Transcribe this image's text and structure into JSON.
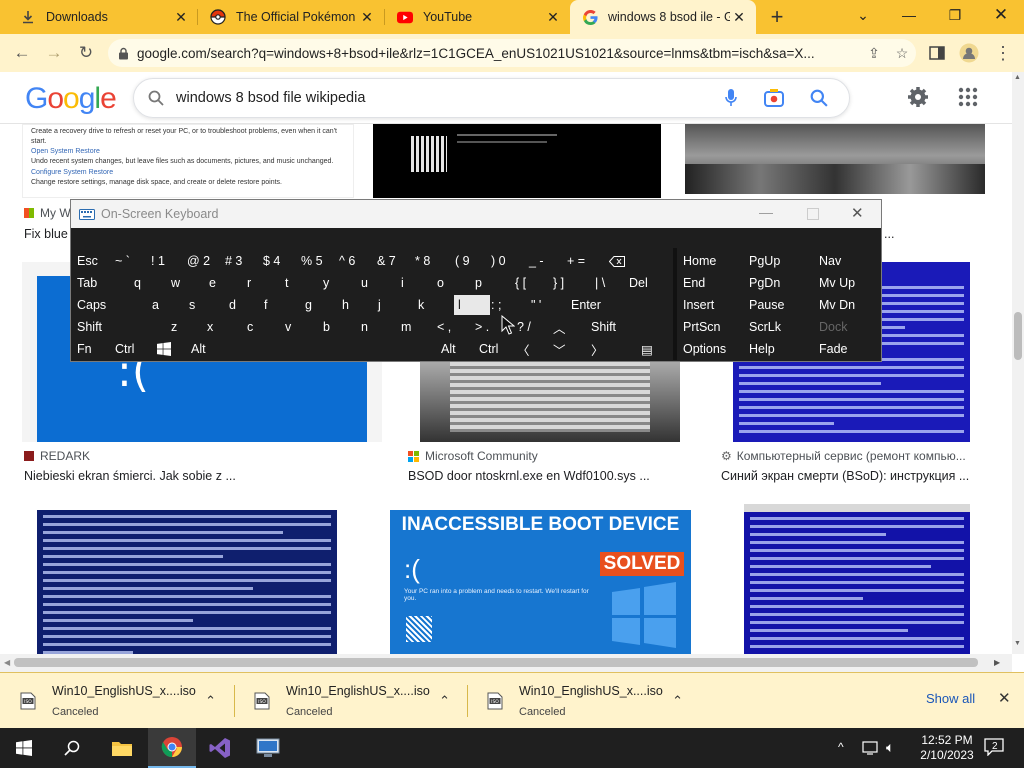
{
  "browser": {
    "tabs": [
      {
        "title": "Downloads",
        "icon": "download-icon"
      },
      {
        "title": "The Official Pokémon W",
        "icon": "pokeball-icon"
      },
      {
        "title": "YouTube",
        "icon": "youtube-icon"
      },
      {
        "title": "windows 8 bsod ile - G",
        "icon": "google-icon",
        "active": true
      }
    ],
    "new_tab": "+",
    "url": "google.com/search?q=windows+8+bsod+ile&rlz=1C1GCEA_enUS1021US1021&source=lnms&tbm=isch&sa=X...",
    "colors": {
      "tabstrip": "#f9c231",
      "toolbar": "#fff3cc"
    }
  },
  "google": {
    "logo": "Google",
    "query": "windows 8 bsod file wikipedia"
  },
  "results": {
    "row1": [
      {
        "source": "My W",
        "title": "Fix blue"
      },
      {
        "source": "",
        "title": ""
      },
      {
        "source": "",
        "title": "..."
      }
    ],
    "row2": [
      {
        "source": "REDARK",
        "title": "Niebieski ekran śmierci. Jak sobie z ..."
      },
      {
        "source": "Microsoft Community",
        "title": "BSOD door ntoskrnl.exe en Wdf0100.sys ..."
      },
      {
        "source": "Компьютерный сервис (ремонт компью...",
        "title": "Синий экран смерти (BSoD): инструкция ..."
      }
    ],
    "row1_left_text": [
      "Create a recovery drive to refresh or reset your PC, or to troubleshoot problems, even when it can't start.",
      "Open System Restore",
      "Undo recent system changes, but leave files such as documents, pictures, and music unchanged.",
      "Configure System Restore",
      "Change restore settings, manage disk space, and create or delete restore points."
    ],
    "inaccessible": {
      "headline": "INACCESSIBLE BOOT DEVICE",
      "badge": "SOLVED",
      "sad": ":(",
      "msg": "Your PC ran into a problem and needs to restart. We'll restart for you."
    }
  },
  "osk": {
    "title": "On-Screen Keyboard",
    "row1": [
      "Esc",
      "~ `",
      "! 1",
      "@ 2",
      "# 3",
      "$ 4",
      "% 5",
      "^ 6",
      "& 7",
      "* 8",
      "( 9",
      ") 0",
      "_ -",
      "+ ="
    ],
    "row2": [
      "Tab",
      "q",
      "w",
      "e",
      "r",
      "t",
      "y",
      "u",
      "i",
      "o",
      "p",
      "{ [",
      "} ]",
      "| \\",
      "Del"
    ],
    "row3": [
      "Caps",
      "a",
      "s",
      "d",
      "f",
      "g",
      "h",
      "j",
      "k",
      "l",
      ": ;",
      "\" '",
      "Enter"
    ],
    "row4": [
      "Shift",
      "z",
      "x",
      "c",
      "v",
      "b",
      "n",
      "m",
      "< ,",
      "> .",
      "? /",
      "Shift"
    ],
    "row5": [
      "Fn",
      "Ctrl",
      "Alt",
      "Alt",
      "Ctrl"
    ],
    "nav": [
      [
        "Home",
        "PgUp",
        "Nav"
      ],
      [
        "End",
        "PgDn",
        "Mv Up"
      ],
      [
        "Insert",
        "Pause",
        "Mv Dn"
      ],
      [
        "PrtScn",
        "ScrLk",
        "Dock"
      ],
      [
        "Options",
        "Help",
        "Fade"
      ]
    ]
  },
  "downloads": {
    "items": [
      {
        "name": "Win10_EnglishUS_x....iso",
        "status": "Canceled"
      },
      {
        "name": "Win10_EnglishUS_x....iso",
        "status": "Canceled"
      },
      {
        "name": "Win10_EnglishUS_x....iso",
        "status": "Canceled"
      }
    ],
    "show_all": "Show all"
  },
  "taskbar": {
    "time": "12:52 PM",
    "date": "2/10/2023",
    "notifications": "2"
  }
}
